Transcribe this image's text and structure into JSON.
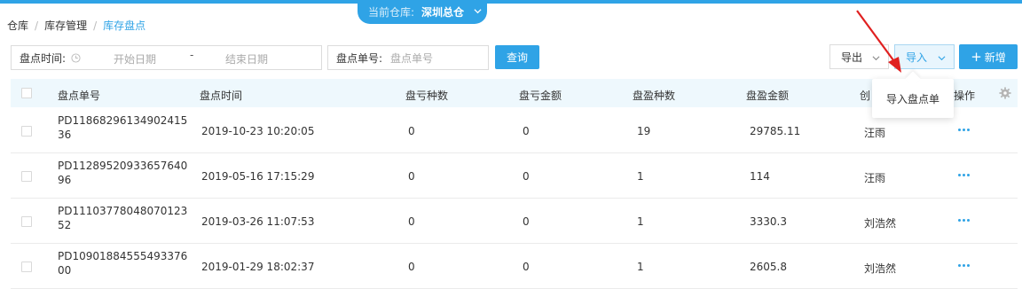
{
  "warehouse": {
    "label": "当前仓库:",
    "value": "深圳总仓"
  },
  "breadcrumb": [
    "仓库",
    "库存管理",
    "库存盘点"
  ],
  "filters": {
    "date_label": "盘点时间:",
    "start_placeholder": "开始日期",
    "dash": "-",
    "end_placeholder": "结束日期",
    "no_label": "盘点单号:",
    "no_placeholder": "盘点单号",
    "query_label": "查询"
  },
  "toolbar": {
    "export_label": "导出",
    "import_label": "导入",
    "new_label": "新增",
    "new_icon": "+"
  },
  "dropdown": {
    "item": "导入盘点单"
  },
  "table": {
    "headers": {
      "no": "盘点单号",
      "time": "盘点时间",
      "loss_kinds": "盘亏种数",
      "loss_amount": "盘亏金额",
      "gain_kinds": "盘盈种数",
      "gain_amount": "盘盈金额",
      "creator": "创",
      "action": "操作"
    },
    "rows": [
      {
        "no": "PD1186829613490241536",
        "time": "2019-10-23 10:20:05",
        "loss_kinds": "0",
        "loss_amount": "0",
        "gain_kinds": "19",
        "gain_amount": "29785.11",
        "creator": "汪雨"
      },
      {
        "no": "PD1128952093365764096",
        "time": "2019-05-16 17:15:29",
        "loss_kinds": "0",
        "loss_amount": "0",
        "gain_kinds": "1",
        "gain_amount": "114",
        "creator": "汪雨"
      },
      {
        "no": "PD1110377804807012352",
        "time": "2019-03-26 11:07:53",
        "loss_kinds": "0",
        "loss_amount": "0",
        "gain_kinds": "1",
        "gain_amount": "3330.3",
        "creator": "刘浩然"
      },
      {
        "no": "PD1090188455549337600",
        "time": "2019-01-29 18:02:37",
        "loss_kinds": "0",
        "loss_amount": "0",
        "gain_kinds": "1",
        "gain_amount": "2605.8",
        "creator": "刘浩然"
      }
    ]
  },
  "colors": {
    "accent": "#2fa3e6",
    "arrow": "#e02020"
  }
}
